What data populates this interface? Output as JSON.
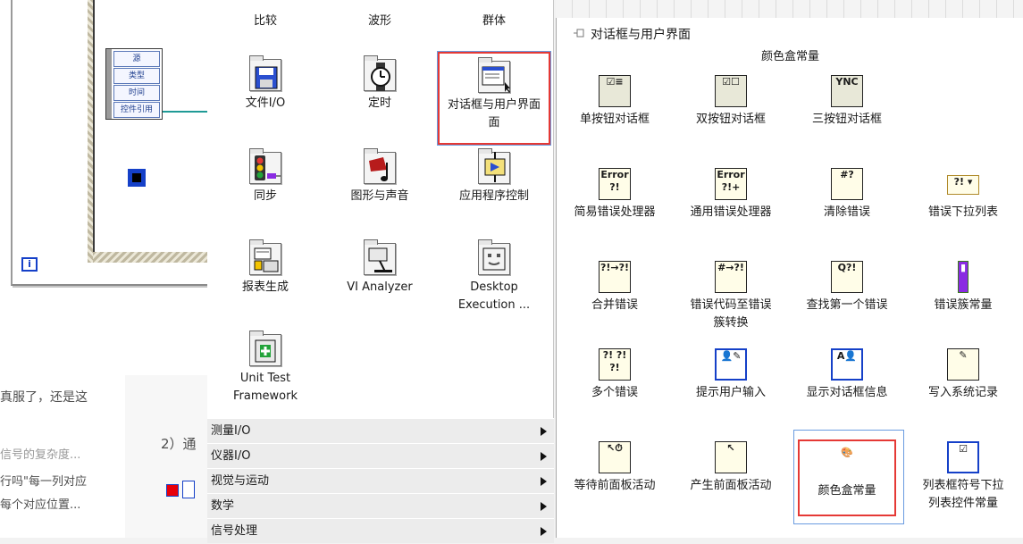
{
  "block_diagram": {
    "cluster_rows": [
      "源",
      "类型",
      "时间",
      "控件引用"
    ],
    "info_glyph": "i"
  },
  "blog": {
    "line1": "真服了，还是这",
    "line2": "信号的复杂度...",
    "line3": "行吗\"每一列对应",
    "line4": "每个对应位置...",
    "line5": "2）通"
  },
  "palette": {
    "top_row": [
      {
        "label": "比较"
      },
      {
        "label": "波形"
      },
      {
        "label": "群体"
      }
    ],
    "items": [
      {
        "label": "文件I/O",
        "icon": "floppy-disk-icon"
      },
      {
        "label": "定时",
        "icon": "watch-icon"
      },
      {
        "label": "对话框与用户界面",
        "label2": "面",
        "icon": "dialog-window-icon"
      },
      {
        "label": "同步",
        "icon": "traffic-light-icon"
      },
      {
        "label": "图形与声音",
        "icon": "music-note-icon"
      },
      {
        "label": "应用程序控制",
        "icon": "app-control-icon"
      },
      {
        "label": "报表生成",
        "icon": "printer-icon"
      },
      {
        "label": "VI Analyzer",
        "icon": "microscope-icon"
      },
      {
        "label": "Desktop",
        "label2": "Execution ...",
        "icon": "desktop-execution-icon"
      },
      {
        "label": "Unit Test",
        "label2": "Framework",
        "icon": "unit-test-icon"
      }
    ],
    "submenus": [
      {
        "label": "测量I/O"
      },
      {
        "label": "仪器I/O"
      },
      {
        "label": "视觉与运动"
      },
      {
        "label": "数学"
      },
      {
        "label": "信号处理"
      }
    ]
  },
  "subpalette": {
    "title": "对话框与用户界面",
    "header": "颜色盒常量",
    "items": [
      {
        "label": "单按钮对话框",
        "glyph": "☑≡"
      },
      {
        "label": "双按钮对话框",
        "glyph": "☑☐"
      },
      {
        "label": "三按钮对话框",
        "glyph": "YNC"
      },
      {
        "label": "简易错误处理器",
        "glyph": "Error ?!"
      },
      {
        "label": "通用错误处理器",
        "glyph": "Error ?!+"
      },
      {
        "label": "清除错误",
        "glyph": "#?"
      },
      {
        "label": "错误下拉列表",
        "glyph": "?! ▾"
      },
      {
        "label": "合并错误",
        "glyph": "?!→?!"
      },
      {
        "label": "错误代码至错误",
        "label2": "簇转换",
        "glyph": "#→?!"
      },
      {
        "label": "查找第一个错误",
        "glyph": "Q?!"
      },
      {
        "label": "错误簇常量",
        "glyph": "▮"
      },
      {
        "label": "多个错误",
        "glyph": "?! ?! ?!"
      },
      {
        "label": "提示用户输入",
        "glyph": "👤✎"
      },
      {
        "label": "显示对话框信息",
        "glyph": "A👤"
      },
      {
        "label": "写入系统记录",
        "glyph": "✎"
      },
      {
        "label": "等待前面板活动",
        "glyph": "↖⏱"
      },
      {
        "label": "产生前面板活动",
        "glyph": "↖"
      },
      {
        "label": "颜色盒常量",
        "glyph": "🎨"
      },
      {
        "label": "列表框符号下拉",
        "label2": "列表控件常量",
        "glyph": "☑"
      }
    ]
  },
  "colors": {
    "selection_red": "#e53935",
    "hover_blue": "#6a9be0",
    "labview_blue": "#1540c8"
  }
}
